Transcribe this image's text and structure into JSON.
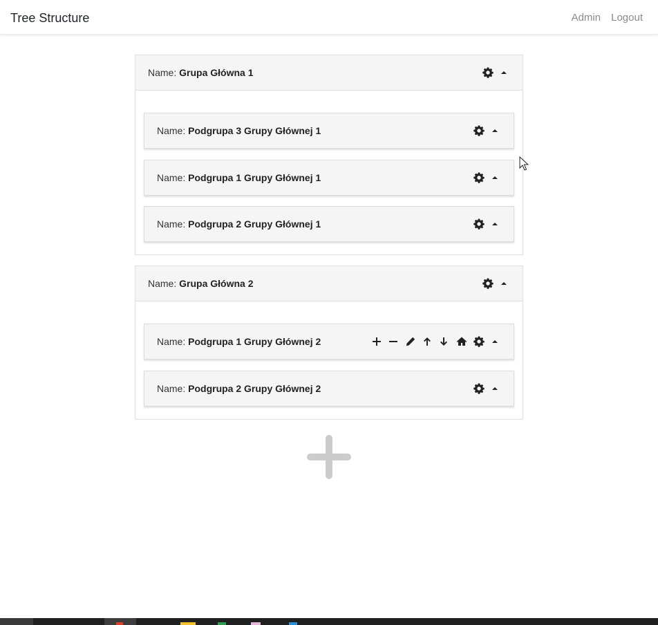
{
  "nav": {
    "brand": "Tree Structure",
    "links": [
      "Admin",
      "Logout"
    ]
  },
  "name_label": "Name:",
  "groups": [
    {
      "name": "Grupa Główna 1",
      "subgroups": [
        {
          "name": "Podgrupa 3 Grupy Głównej 1"
        },
        {
          "name": "Podgrupa 1 Grupy Głównej 1"
        },
        {
          "name": "Podgrupa 2 Grupy Głównej 1"
        }
      ]
    },
    {
      "name": "Grupa Główna 2",
      "subgroups": [
        {
          "name": "Podgrupa 1 Grupy Głównej 2",
          "hover_actions": [
            "add-icon",
            "remove-icon",
            "edit-icon",
            "move-up-icon",
            "move-down-icon",
            "home-icon"
          ]
        },
        {
          "name": "Podgrupa 2 Grupy Głównej 2"
        }
      ]
    }
  ],
  "icons": {
    "settings": "gear-icon",
    "collapse": "caret-up-icon",
    "add_group": "plus-icon"
  },
  "colors": {
    "header_bg": "#f5f5f5",
    "nav_link": "#8a8a8a",
    "add_plus": "#cccccc",
    "text": "#212529"
  }
}
